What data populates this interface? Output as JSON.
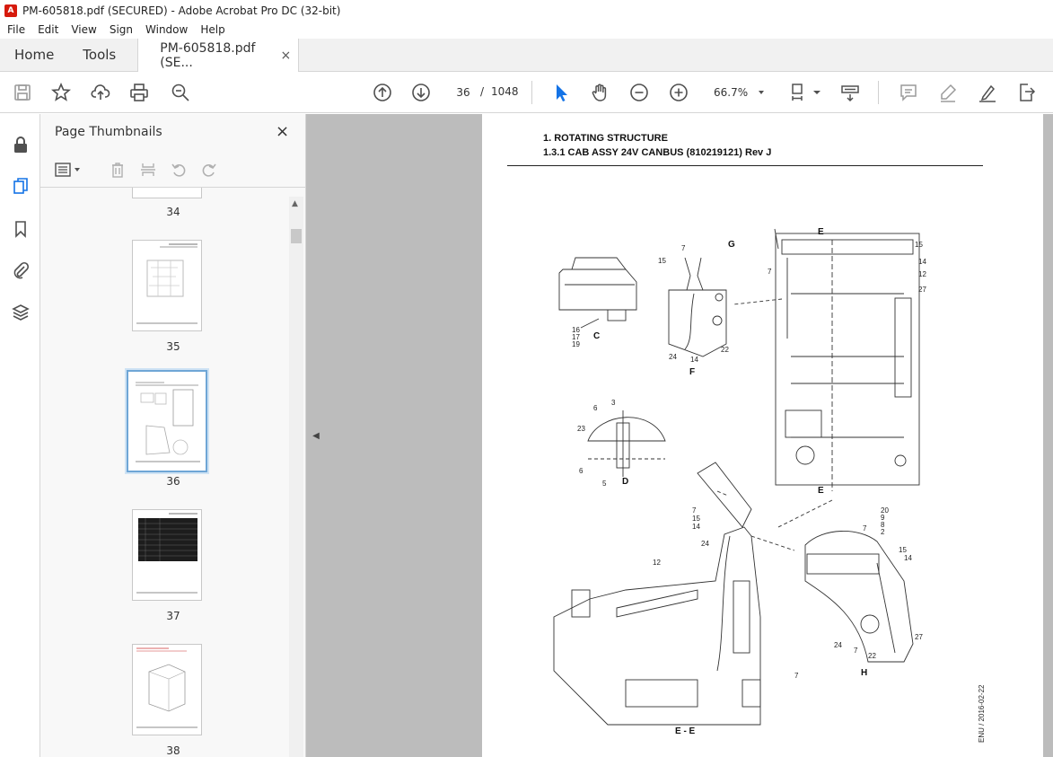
{
  "window": {
    "title": "PM-605818.pdf (SECURED) - Adobe Acrobat Pro DC (32-bit)"
  },
  "menu": [
    "File",
    "Edit",
    "View",
    "Sign",
    "Window",
    "Help"
  ],
  "tabs": {
    "home": "Home",
    "tools": "Tools",
    "document": "PM-605818.pdf (SE...",
    "close": "×"
  },
  "toolbar": {
    "page_current": "36",
    "page_separator": "/",
    "page_total": "1048",
    "zoom": "66.7%",
    "icons": [
      "save-icon",
      "star-icon",
      "upload-icon",
      "print-icon",
      "zoom-search-icon",
      "page-up-icon",
      "page-down-icon",
      "select-arrow-icon",
      "hand-icon",
      "zoom-out-icon",
      "zoom-in-icon",
      "page-fit-icon",
      "keyboard-icon",
      "comment-icon",
      "highlight-icon",
      "sign-icon",
      "export-icon"
    ]
  },
  "rail": {
    "icons": [
      "lock-icon",
      "pages-icon",
      "bookmark-icon",
      "attachment-icon",
      "layers-icon"
    ]
  },
  "thumbnails_panel": {
    "title": "Page Thumbnails",
    "close": "×",
    "pages": [
      "34",
      "35",
      "36",
      "37",
      "38"
    ],
    "selected": "36"
  },
  "document": {
    "heading1": "1. ROTATING STRUCTURE",
    "heading2": "1.3.1 CAB ASSY 24V CANBUS (810219121) Rev J",
    "footer_code": "ENU / 2016-02-22",
    "views": [
      "C",
      "F",
      "G",
      "D",
      "E",
      "E",
      "E - E",
      "H"
    ],
    "callouts": {
      "view_c": [
        "16",
        "17",
        "19"
      ],
      "view_f": [
        "7",
        "15",
        "24",
        "14",
        "22"
      ],
      "view_d": [
        "6",
        "3",
        "23",
        "6",
        "5"
      ],
      "main_top": [
        "15",
        "14",
        "7",
        "12",
        "27"
      ],
      "ee": [
        "7",
        "15",
        "14",
        "24",
        "12",
        "7"
      ],
      "view_h": [
        "20",
        "9",
        "8",
        "2",
        "7",
        "15",
        "14",
        "27",
        "24",
        "7",
        "22"
      ]
    }
  },
  "colors": {
    "accent": "#1473e6",
    "doc_background": "#bcbcbc"
  }
}
